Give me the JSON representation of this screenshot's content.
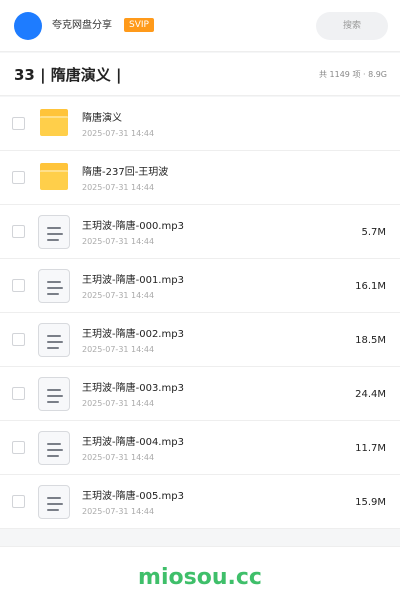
{
  "header": {
    "app_name": "夸克网盘分享",
    "badge": "SVIP",
    "search_placeholder": "搜索"
  },
  "folder": {
    "title": "33 | 隋唐演义 |",
    "summary": "共 1149 项 · 8.9G"
  },
  "files": [
    {
      "type": "folder",
      "name": "隋唐演义",
      "date": "2025-07-31 14:44",
      "size": ""
    },
    {
      "type": "folder",
      "name": "隋唐-237回-王玥波",
      "date": "2025-07-31 14:44",
      "size": ""
    },
    {
      "type": "file",
      "name": "王玥波-隋唐-000.mp3",
      "date": "2025-07-31 14:44",
      "size": "5.7M"
    },
    {
      "type": "file",
      "name": "王玥波-隋唐-001.mp3",
      "date": "2025-07-31 14:44",
      "size": "16.1M"
    },
    {
      "type": "file",
      "name": "王玥波-隋唐-002.mp3",
      "date": "2025-07-31 14:44",
      "size": "18.5M"
    },
    {
      "type": "file",
      "name": "王玥波-隋唐-003.mp3",
      "date": "2025-07-31 14:44",
      "size": "24.4M"
    },
    {
      "type": "file",
      "name": "王玥波-隋唐-004.mp3",
      "date": "2025-07-31 14:44",
      "size": "11.7M"
    },
    {
      "type": "file",
      "name": "王玥波-隋唐-005.mp3",
      "date": "2025-07-31 14:44",
      "size": "15.9M"
    }
  ],
  "footer": {
    "watermark": "miosou.cc"
  },
  "colors": {
    "accent": "#1e7cff",
    "svip": "#ff9a1a",
    "folder": "#ffc43a",
    "watermark": "#3fbf6a"
  }
}
